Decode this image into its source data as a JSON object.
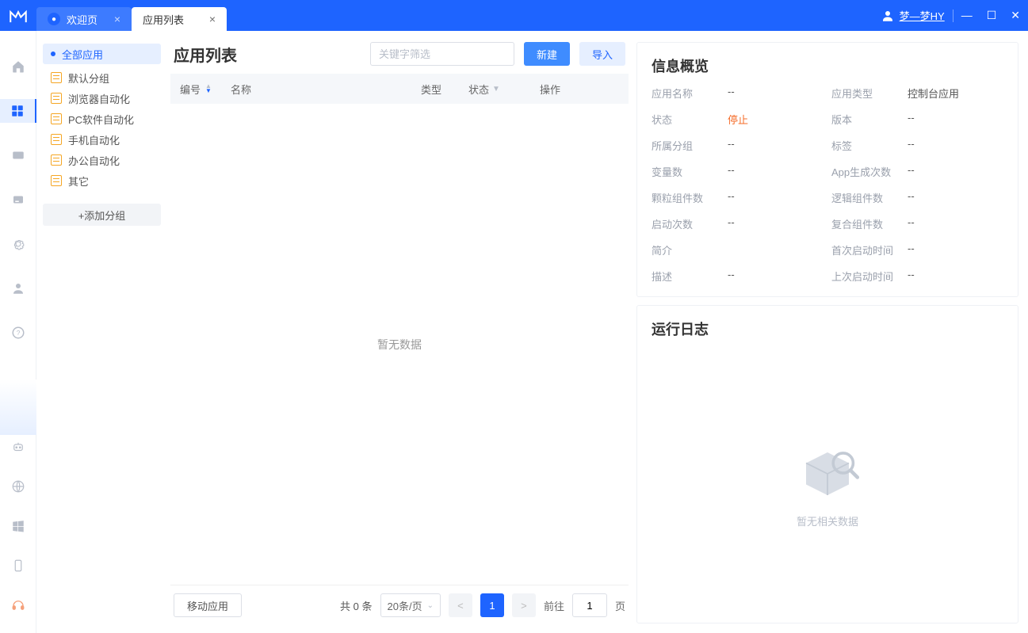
{
  "titlebar": {
    "tabs": [
      {
        "label": "欢迎页",
        "kind": "welcome"
      },
      {
        "label": "应用列表",
        "kind": "active"
      }
    ],
    "user": "梦—梦HY"
  },
  "sidebar": {
    "all_label": "全部应用",
    "groups": [
      "默认分组",
      "浏览器自动化",
      "PC软件自动化",
      "手机自动化",
      "办公自动化",
      "其它"
    ],
    "add_group_label": "+添加分组"
  },
  "center": {
    "title": "应用列表",
    "search_placeholder": "关键字筛选",
    "btn_new": "新建",
    "btn_import": "导入",
    "columns": {
      "num": "编号",
      "name": "名称",
      "type": "类型",
      "state": "状态",
      "op": "操作"
    },
    "empty_text": "暂无数据",
    "footer": {
      "move_label": "移动应用",
      "total_text": "共 0 条",
      "page_size_label": "20条/页",
      "prev": "<",
      "page": "1",
      "next": ">",
      "goto_label": "前往",
      "goto_value": "1",
      "goto_unit": "页"
    }
  },
  "right": {
    "overview_title": "信息概览",
    "log_title": "运行日志",
    "log_empty": "暂无相关数据",
    "info": {
      "app_name_l": "应用名称",
      "app_name_v": "--",
      "app_type_l": "应用类型",
      "app_type_v": "控制台应用",
      "status_l": "状态",
      "status_v": "停止",
      "version_l": "版本",
      "version_v": "--",
      "group_l": "所属分组",
      "group_v": "--",
      "tag_l": "标签",
      "tag_v": "--",
      "var_l": "变量数",
      "var_v": "--",
      "gen_l": "App生成次数",
      "gen_v": "--",
      "comp_g_l": "颗粒组件数",
      "comp_g_v": "--",
      "comp_l_l": "逻辑组件数",
      "comp_l_v": "--",
      "launch_l": "启动次数",
      "launch_v": "--",
      "comp_c_l": "复合组件数",
      "comp_c_v": "--",
      "brief_l": "简介",
      "brief_v": "",
      "first_l": "首次启动时间",
      "first_v": "--",
      "desc_l": "描述",
      "desc_v": "--",
      "last_l": "上次启动时间",
      "last_v": "--"
    }
  }
}
